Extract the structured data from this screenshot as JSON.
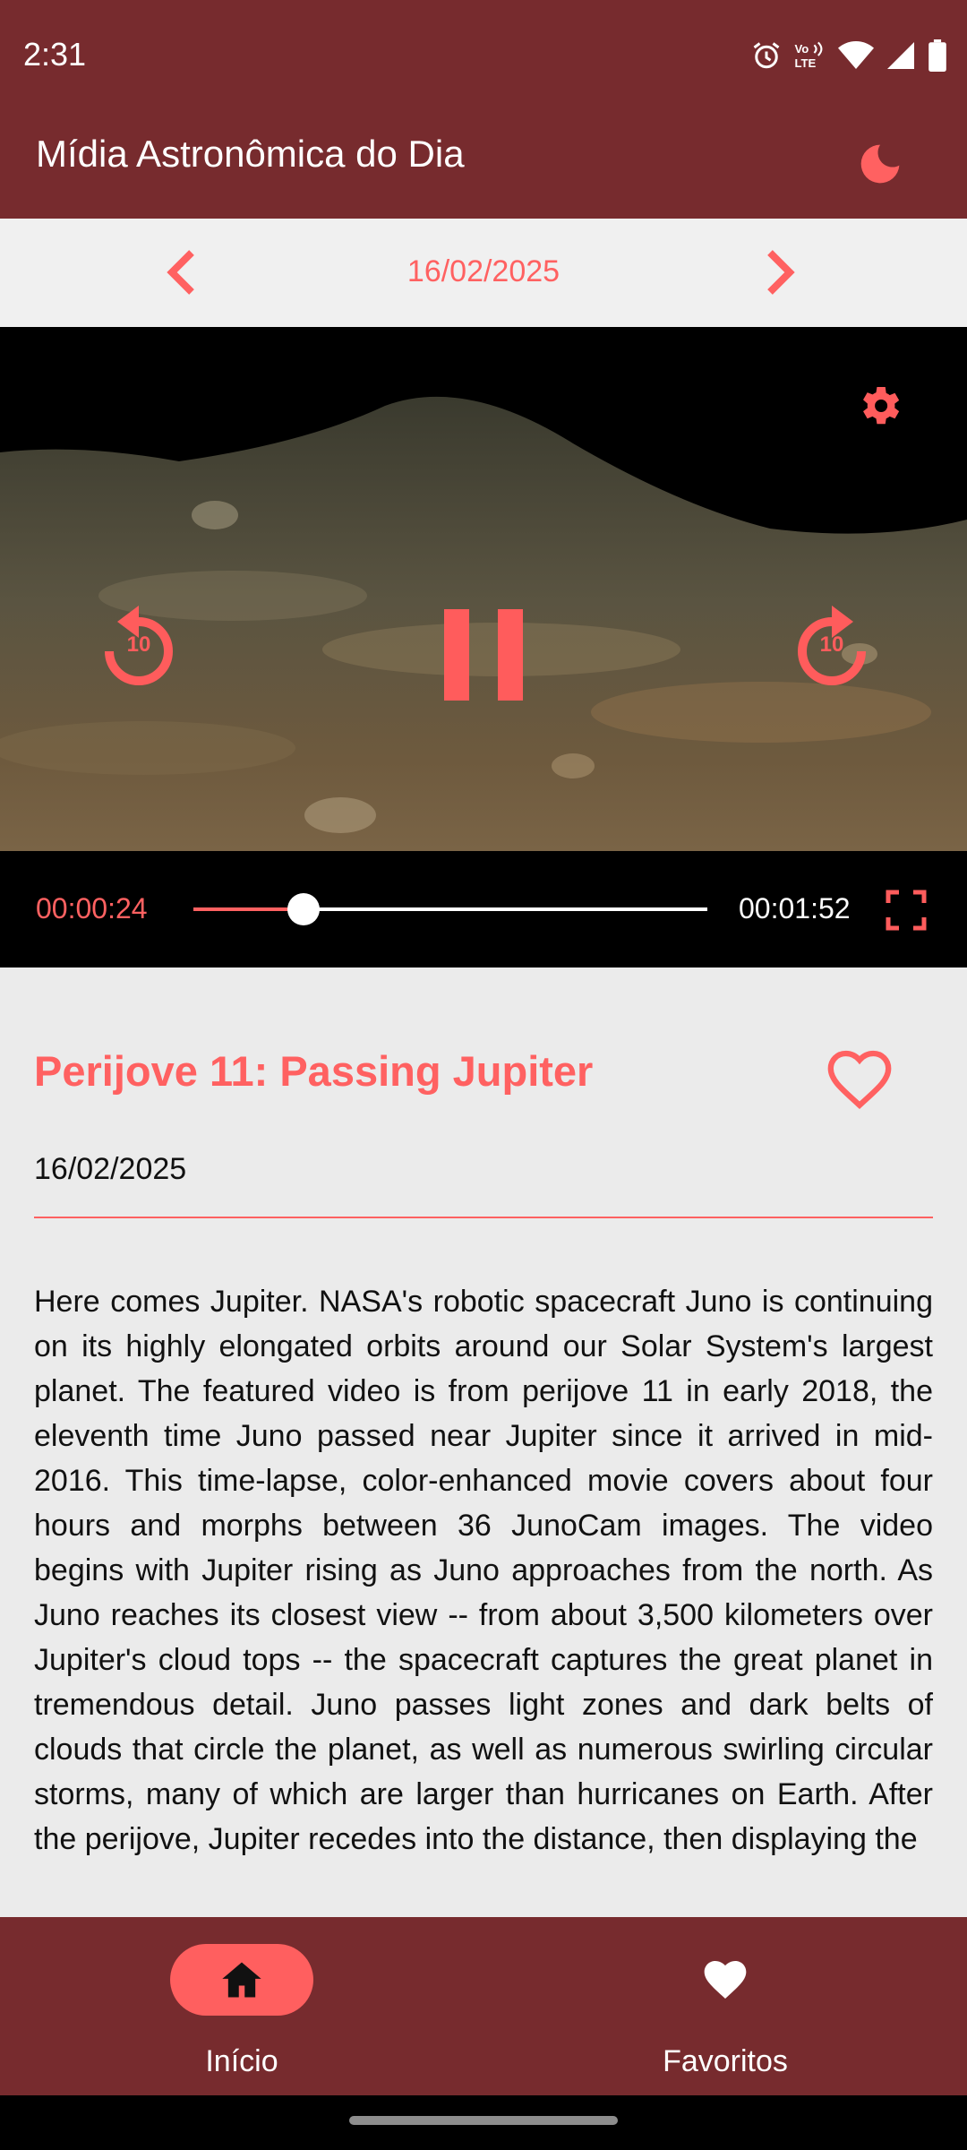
{
  "status_bar": {
    "time": "2:31",
    "icons": [
      "alarm-icon",
      "volte-icon",
      "wifi-icon",
      "signal-icon",
      "battery-icon"
    ]
  },
  "app_bar": {
    "title": "Mídia Astronômica do Dia",
    "theme_icon": "moon-icon"
  },
  "date_nav": {
    "date": "16/02/2025"
  },
  "player": {
    "current_time": "00:00:24",
    "total_time": "00:01:52",
    "progress": 0.214,
    "rewind_label": "10",
    "forward_label": "10"
  },
  "media": {
    "title": "Perijove 11: Passing Jupiter",
    "date": "16/02/2025",
    "description": "Here comes Jupiter. NASA's robotic spacecraft Juno is continuing on its highly elongated orbits around our Solar System's largest planet. The featured video is from perijove 11 in early 2018, the eleventh time Juno passed near Jupiter since it arrived in mid-2016. This time-lapse, color-enhanced movie covers about four hours and morphs between 36 JunoCam images. The video begins with Jupiter rising as Juno approaches from the north. As Juno reaches its closest view -- from about 3,500 kilometers over Jupiter's cloud tops -- the spacecraft captures the great planet in tremendous detail. Juno passes light zones and dark belts of clouds that circle the planet, as well as numerous swirling circular storms, many of which are larger than hurricanes on Earth. After the perijove, Jupiter recedes into the distance, then displaying the"
  },
  "bottom_nav": {
    "items": [
      {
        "label": "Início",
        "icon": "home-icon",
        "active": true
      },
      {
        "label": "Favoritos",
        "icon": "heart-icon",
        "active": false
      }
    ]
  },
  "colors": {
    "app_bar": "#772b2e",
    "accent": "#ff6161",
    "background": "#ebebeb"
  }
}
